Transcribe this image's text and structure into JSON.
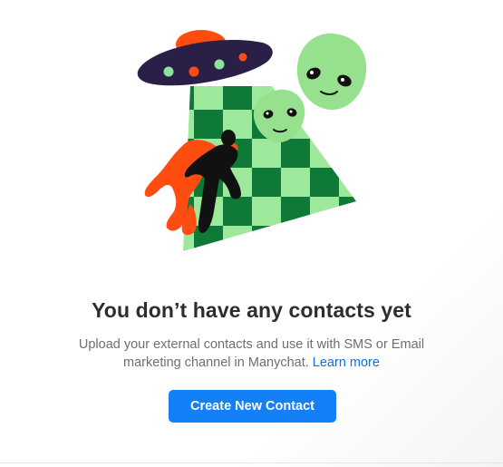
{
  "empty_state": {
    "title": "You don’t have any contacts yet",
    "description": "Upload your external contacts and use it with SMS or Email marketing channel in Manychat.",
    "learn_more_label": "Learn more",
    "cta_label": "Create New Contact"
  },
  "illustration": {
    "icon": "alien-abduction-illustration",
    "colors": {
      "ufo_body": "#2a2047",
      "ufo_dome": "#ff4d12",
      "ufo_lights": "#ff4d12",
      "ufo_dots_green": "#8ee39b",
      "beam_dark": "#0f7a38",
      "beam_light": "#9ee89c",
      "alien_skin": "#97e08e",
      "human_silhouette": "#111111",
      "human_shadow": "#ff4d12"
    }
  },
  "theme": {
    "accent": "#1480f8",
    "link": "#0b74e5",
    "title_color": "#2b2d31",
    "text_muted": "#6b6f76"
  }
}
